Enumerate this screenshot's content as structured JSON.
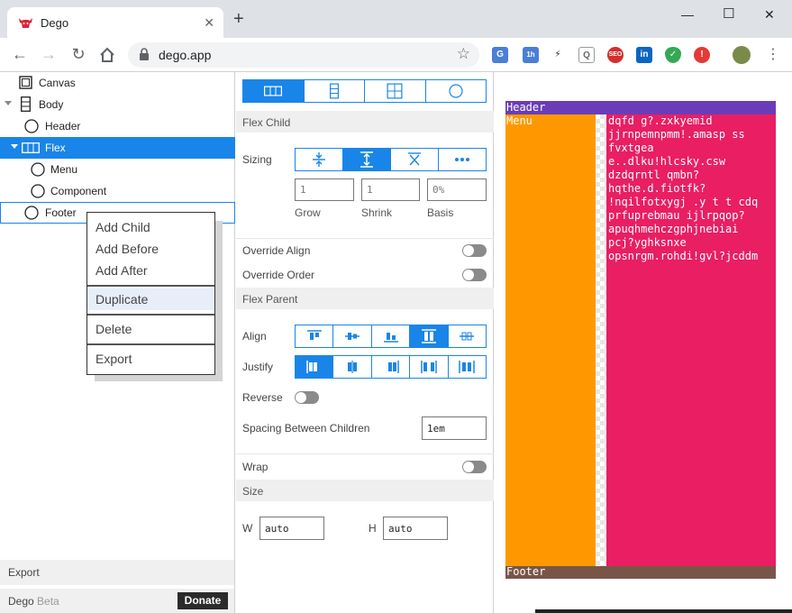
{
  "browser": {
    "tab_title": "Dego",
    "close_glyph": "✕",
    "new_tab_glyph": "+",
    "url": "dego.app",
    "window_controls": [
      "—",
      "☐",
      "✕"
    ],
    "extensions": [
      {
        "name": "translate-extension-icon",
        "color": "#4a7fd6",
        "text": "G"
      },
      {
        "name": "calendar-extension-icon",
        "color": "#4a7fd6",
        "text": "1h"
      },
      {
        "name": "bolt-extension-icon",
        "color": "#ffffff",
        "text": "⚡"
      },
      {
        "name": "magnifier-extension-icon",
        "color": "#9e9e9e",
        "text": "Q"
      },
      {
        "name": "seo-extension-icon",
        "color": "#d32f2f",
        "text": "SEO"
      },
      {
        "name": "linkedin-extension-icon",
        "color": "#0a66c2",
        "text": "in"
      },
      {
        "name": "shield-extension-icon",
        "color": "#34a853",
        "text": "✓"
      },
      {
        "name": "record-extension-icon",
        "color": "#e53935",
        "text": "!"
      }
    ]
  },
  "tree": {
    "items": [
      {
        "label": "Canvas"
      },
      {
        "label": "Body"
      },
      {
        "label": "Header"
      },
      {
        "label": "Flex"
      },
      {
        "label": "Menu"
      },
      {
        "label": "Component"
      },
      {
        "label": "Footer"
      }
    ],
    "context_menu": [
      "Add Child",
      "Add Before",
      "Add After",
      "Duplicate",
      "Delete",
      "Export"
    ],
    "export_label": "Export",
    "brand": "Dego",
    "beta": "Beta",
    "donate_label": "Donate"
  },
  "props": {
    "flex_child_title": "Flex Child",
    "sizing_label": "Sizing",
    "grow": {
      "label": "Grow",
      "value": "1"
    },
    "shrink": {
      "label": "Shrink",
      "value": "1"
    },
    "basis": {
      "label": "Basis",
      "value": "0%"
    },
    "override_align": "Override Align",
    "override_order": "Override Order",
    "flex_parent_title": "Flex Parent",
    "align_label": "Align",
    "justify_label": "Justify",
    "reverse_label": "Reverse",
    "spacing_label": "Spacing Between Children",
    "spacing_value": "1em",
    "wrap_label": "Wrap",
    "size_title": "Size",
    "w_label": "W",
    "w_value": "auto",
    "h_label": "H",
    "h_value": "auto",
    "accent": "#1a85e8"
  },
  "preview": {
    "header": "Header",
    "menu": "Menu",
    "footer": "Footer",
    "component_text": "dqfd g?.zxkyemid\njjrnpemnpmm!.amasp ss\nfvxtgea\ne..dlku!hlcsky.csw\ndzdqrntl qmbn?\nhqthe.d.fiotfk?\n!nqilfotxygj .y t t cdq\nprfuprebmau ijlrpqop?\napuqhmehczgphjnebiai\npcj?yghksnxe\nopsnrgm.rohdi!gvl?jcddm",
    "colors": {
      "header": "#6a3db8",
      "menu": "#ff9800",
      "component": "#e91e63",
      "footer": "#795548"
    }
  }
}
